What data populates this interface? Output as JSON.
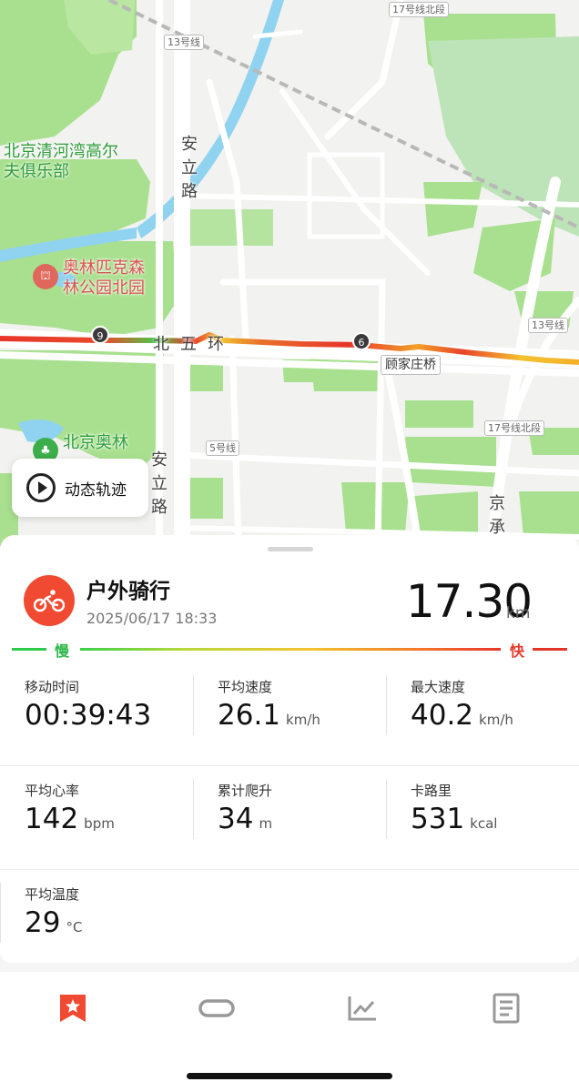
{
  "map": {
    "labels": {
      "golf_club": "北京清河湾高尔夫俱乐部",
      "olympic_north_park": "奥林匹克森林公园北园",
      "olympic_park": "北京奥林",
      "anli_road_top": "安立路",
      "anli_road_bottom": "安立路",
      "north_5th_ring": "北五环",
      "gujiazhuang_bridge": "顾家庄桥",
      "line13_top": "13号线",
      "line13_right": "13号线",
      "line17_top": "17号线北段",
      "line17_right": "17号线北段",
      "line5": "5号线",
      "jingcheng": "京承"
    },
    "km_markers": [
      "9",
      "6"
    ],
    "route_colors": {
      "slow": "#2ec94a",
      "fast": "#e3342a"
    }
  },
  "replay": {
    "label": "动态轨迹",
    "icon": "play-icon"
  },
  "activity": {
    "title": "户外骑行",
    "datetime": "2025/06/17 18:33",
    "distance": "17.30",
    "distance_unit": "km",
    "icon": "cycling-icon",
    "accent": "#f04a32"
  },
  "speed_scale": {
    "slow": "慢",
    "fast": "快"
  },
  "stats": [
    {
      "label": "移动时间",
      "value": "00:39:43",
      "unit": ""
    },
    {
      "label": "平均速度",
      "value": "26.1",
      "unit": "km/h"
    },
    {
      "label": "最大速度",
      "value": "40.2",
      "unit": "km/h"
    },
    {
      "label": "平均心率",
      "value": "142",
      "unit": "bpm"
    },
    {
      "label": "累计爬升",
      "value": "34",
      "unit": "m"
    },
    {
      "label": "卡路里",
      "value": "531",
      "unit": "kcal"
    },
    {
      "label": "平均温度",
      "value": "29",
      "unit": "°C"
    }
  ],
  "tabs": [
    {
      "icon": "bookmark-star-icon",
      "active": true,
      "color": "#f04a32"
    },
    {
      "icon": "route-loop-icon",
      "active": false
    },
    {
      "icon": "line-chart-icon",
      "active": false
    },
    {
      "icon": "document-icon",
      "active": false
    }
  ]
}
